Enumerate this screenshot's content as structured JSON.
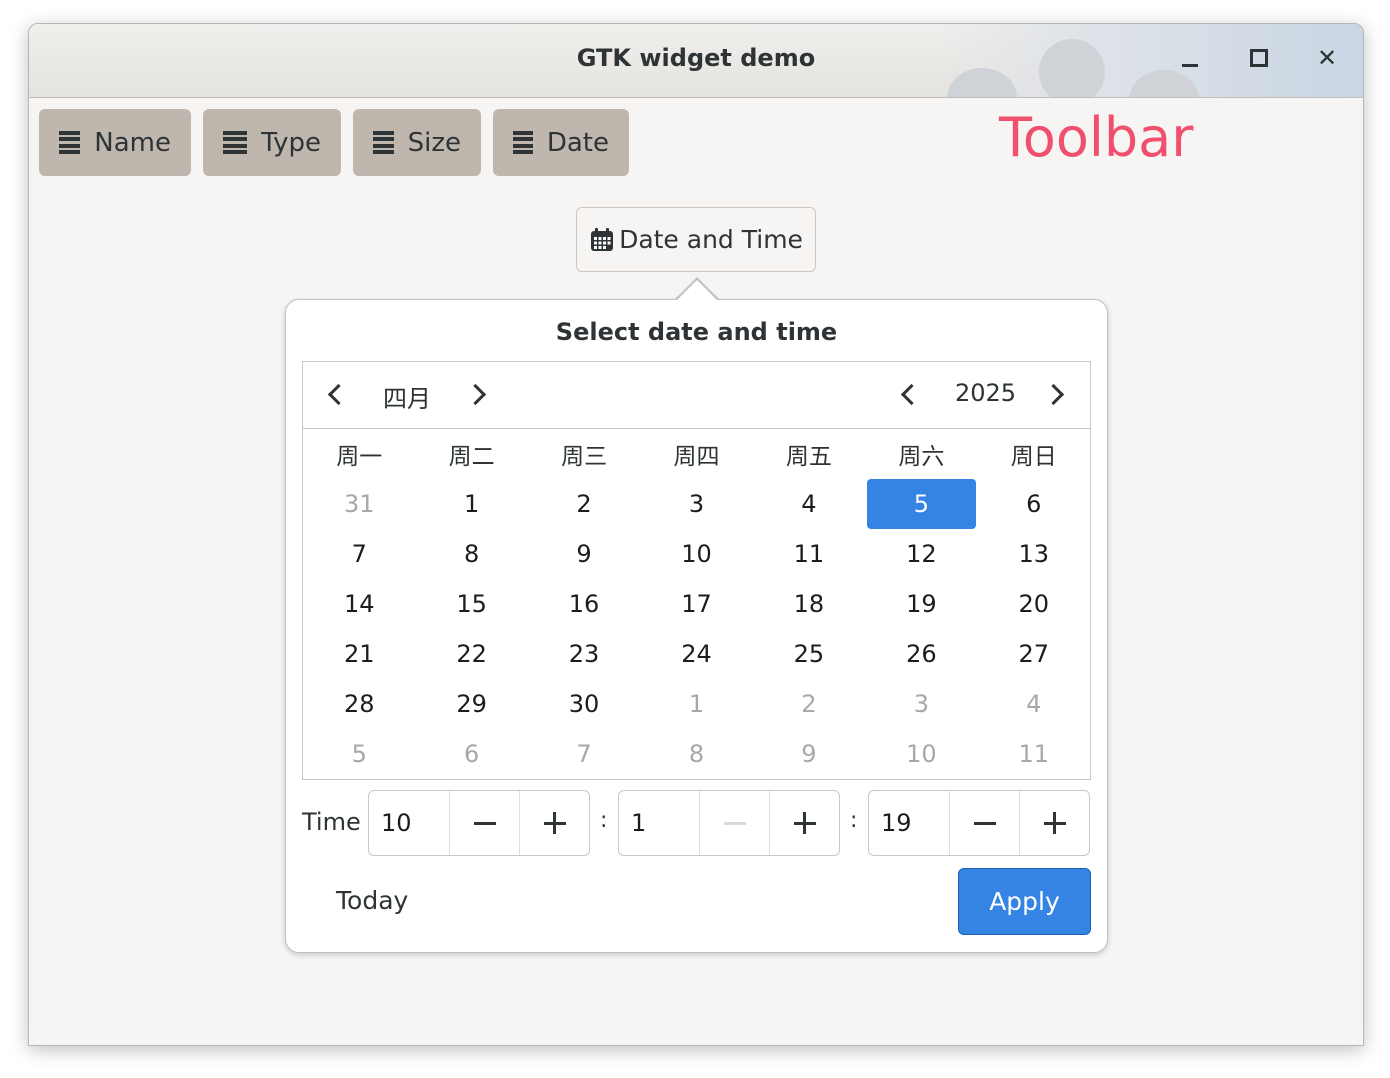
{
  "window": {
    "title": "GTK widget demo"
  },
  "toolbar": {
    "buttons": [
      {
        "label": "Name",
        "icon": "list-icon"
      },
      {
        "label": "Type",
        "icon": "list-icon"
      },
      {
        "label": "Size",
        "icon": "list-icon"
      },
      {
        "label": "Date",
        "icon": "list-icon"
      }
    ],
    "overlay_label": "Toolbar"
  },
  "date_time_button": {
    "label": "Date and Time",
    "icon": "calendar-icon"
  },
  "popover": {
    "title": "Select date and time",
    "calendar": {
      "month": "四月",
      "year": "2025",
      "weekdays": [
        "周一",
        "周二",
        "周三",
        "周四",
        "周五",
        "周六",
        "周日"
      ],
      "weeks": [
        [
          "31",
          "1",
          "2",
          "3",
          "4",
          "5",
          "6"
        ],
        [
          "7",
          "8",
          "9",
          "10",
          "11",
          "12",
          "13"
        ],
        [
          "14",
          "15",
          "16",
          "17",
          "18",
          "19",
          "20"
        ],
        [
          "21",
          "22",
          "23",
          "24",
          "25",
          "26",
          "27"
        ],
        [
          "28",
          "29",
          "30",
          "1",
          "2",
          "3",
          "4"
        ],
        [
          "5",
          "6",
          "7",
          "8",
          "9",
          "10",
          "11"
        ]
      ],
      "selected_day": "5"
    },
    "time": {
      "label": "Time",
      "hour": "10",
      "minute": "1",
      "second": "19",
      "separator": ":"
    },
    "today_label": "Today",
    "apply_label": "Apply"
  },
  "colors": {
    "accent": "#3584e4",
    "toolbar_button": "#bfb7ae",
    "toolbar_label": "#f0506e"
  }
}
